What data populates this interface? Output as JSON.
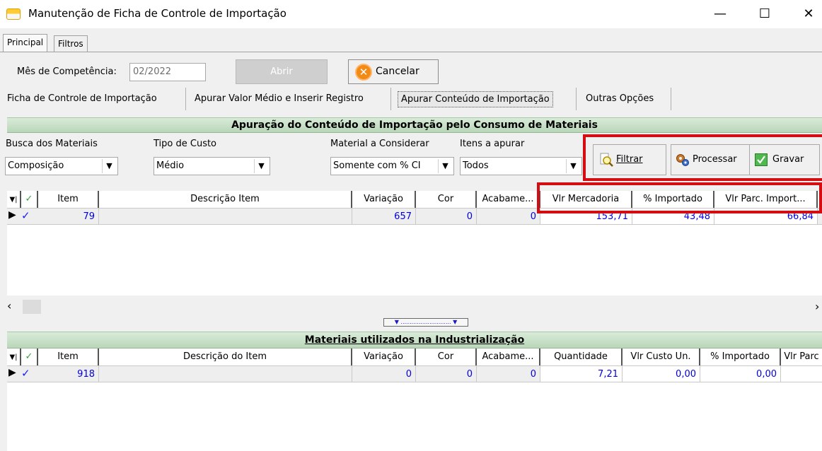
{
  "window": {
    "title": "Manutenção de Ficha de Controle de Importação",
    "min": "—",
    "max": "☐",
    "close": "✕"
  },
  "tabs": [
    {
      "label": "Principal"
    },
    {
      "label": "Filtros"
    }
  ],
  "competencia": {
    "label": "Mês de Competência:",
    "value": "02/2022",
    "abrir_label": "Abrir",
    "cancelar_label": "Cancelar"
  },
  "subtabs": [
    {
      "label": "Ficha de Controle de Importação"
    },
    {
      "label": "Apurar Valor Médio e Inserir Registro"
    },
    {
      "label": "Apurar Conteúdo de Importação"
    },
    {
      "label": "Outras Opções"
    }
  ],
  "apuracao": {
    "title": "Apuração do Conteúdo de Importação pelo Consumo de Materiais",
    "busca": {
      "label": "Busca dos Materiais",
      "value": "Composição"
    },
    "tipo": {
      "label": "Tipo de Custo",
      "value": "Médio"
    },
    "material": {
      "label": "Material a Considerar",
      "value": "Somente com % CI"
    },
    "itens": {
      "label": "Itens a apurar",
      "value": "Todos"
    },
    "buttons": {
      "filtrar": "Filtrar",
      "processar": "Processar",
      "gravar": "Gravar"
    },
    "columns": [
      "Item",
      "Descrição Item",
      "Variação",
      "Cor",
      "Acabame...",
      "Vlr Mercadoria",
      "% Importado",
      "Vlr Parc. Import..."
    ],
    "row": {
      "item": "79",
      "descricao": "",
      "variacao": "657",
      "cor": "0",
      "acabamento": "0",
      "vlr_mercadoria": "153,71",
      "pct_importado": "43,48",
      "vlr_parc": "66,84"
    }
  },
  "materiais": {
    "title": "Materiais utilizados na Industrialização",
    "columns": [
      "Item",
      "Descrição do Item",
      "Variação",
      "Cor",
      "Acabame...",
      "Quantidade",
      "Vlr Custo Un.",
      "% Importado",
      "Vlr Parc"
    ],
    "row": {
      "item": "918",
      "descricao": "",
      "variacao": "0",
      "cor": "0",
      "acabamento": "0",
      "quantidade": "7,21",
      "vlr_custo": "0,00",
      "pct_importado": "0,00",
      "vlr_parc": ""
    }
  },
  "icons": {
    "cancel": "x-circle-icon",
    "filtrar": "magnifier-document-icon",
    "processar": "gears-icon",
    "gravar": "checkbox-icon"
  },
  "colors": {
    "highlight": "#d40d12",
    "value_text": "#0000e0",
    "green_header": "#c6dfc6"
  }
}
